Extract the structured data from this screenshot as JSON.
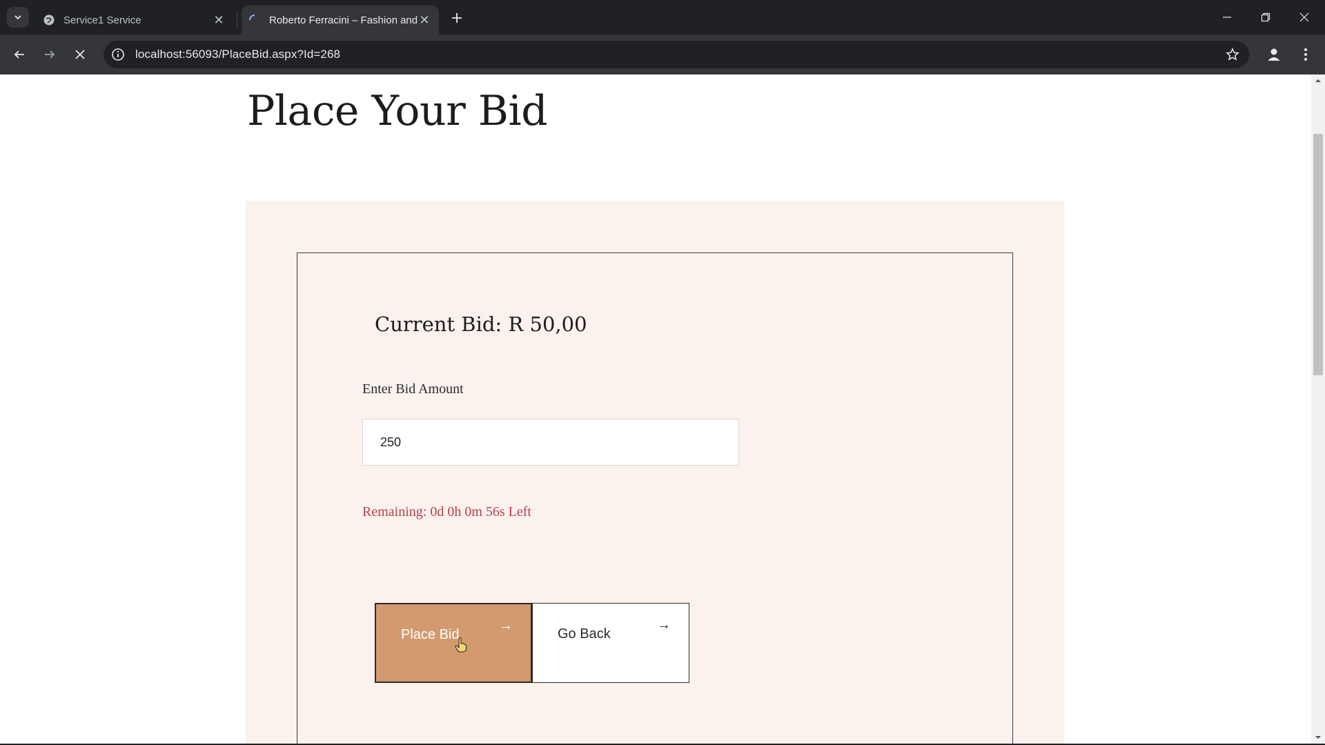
{
  "browser": {
    "tabs": [
      {
        "title": "Service1 Service",
        "active": false
      },
      {
        "title": "Roberto Ferracini – Fashion and",
        "active": true
      }
    ],
    "url": "localhost:56093/PlaceBid.aspx?Id=268"
  },
  "page": {
    "title": "Place Your Bid",
    "current_bid": "Current Bid: R 50,00",
    "bid_label": "Enter Bid Amount",
    "bid_value": "250",
    "remaining": "Remaining: 0d 0h 0m 56s Left",
    "place_bid_label": "Place Bid",
    "go_back_label": "Go Back",
    "arrow": "→"
  },
  "colors": {
    "panel_bg": "#fbf1ed",
    "primary_button": "#d39a6f",
    "remaining_text": "#b5404a"
  }
}
